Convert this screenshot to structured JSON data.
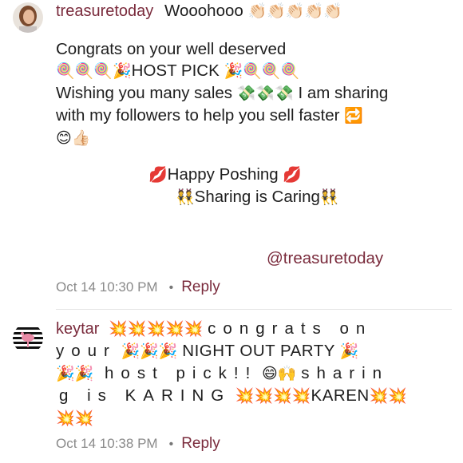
{
  "comments": [
    {
      "username": "treasuretoday",
      "header_text": "Wooohooo",
      "header_emoji": "👏🏻👏🏻👏🏻👏🏻👏🏻",
      "lines": {
        "l1": "Congrats on your well deserved",
        "l2_emoji_a": "🍭🍭🍭🎉",
        "l2_text": "HOST PICK",
        "l2_emoji_b": "🎉🍭🍭🍭",
        "l3_text_a": "Wishing you many sales",
        "l3_emoji": "💸💸💸",
        "l3_text_b": "I am sharing",
        "l4_text": "with my followers to help you sell faster",
        "l4_emoji": "🔁",
        "l5_emoji": "😊👍🏻",
        "l6_emoji_a": "💋",
        "l6_text": "Happy Poshing",
        "l6_emoji_b": "💋",
        "l7_emoji_a": "👯",
        "l7_text": "Sharing is Caring",
        "l7_emoji_b": "👯",
        "mention": "@treasuretoday"
      },
      "timestamp": "Oct 14 10:30 PM",
      "separator": "•",
      "reply_label": "Reply"
    },
    {
      "username": "keytar",
      "lines": {
        "l1_emoji": "💥💥💥💥💥",
        "l1_text": "congrats on",
        "l2_text_a": "your",
        "l2_emoji_a": "🎉🎉🎉",
        "l2_text_b": "NIGHT OUT PARTY",
        "l2_emoji_b": "🎉",
        "l3_emoji": "🎉🎉",
        "l3_text_a": "host pick!!",
        "l3_emoji_b": "😄🙌",
        "l3_text_b": "sharin",
        "l4_text_a": "g is KARING",
        "l4_emoji_a": "💥💥💥💥",
        "l4_text_b": "KAREN",
        "l4_emoji_b": "💥💥",
        "l5_emoji": "💥💥"
      },
      "timestamp": "Oct 14 10:38 PM",
      "separator": "•",
      "reply_label": "Reply"
    }
  ]
}
